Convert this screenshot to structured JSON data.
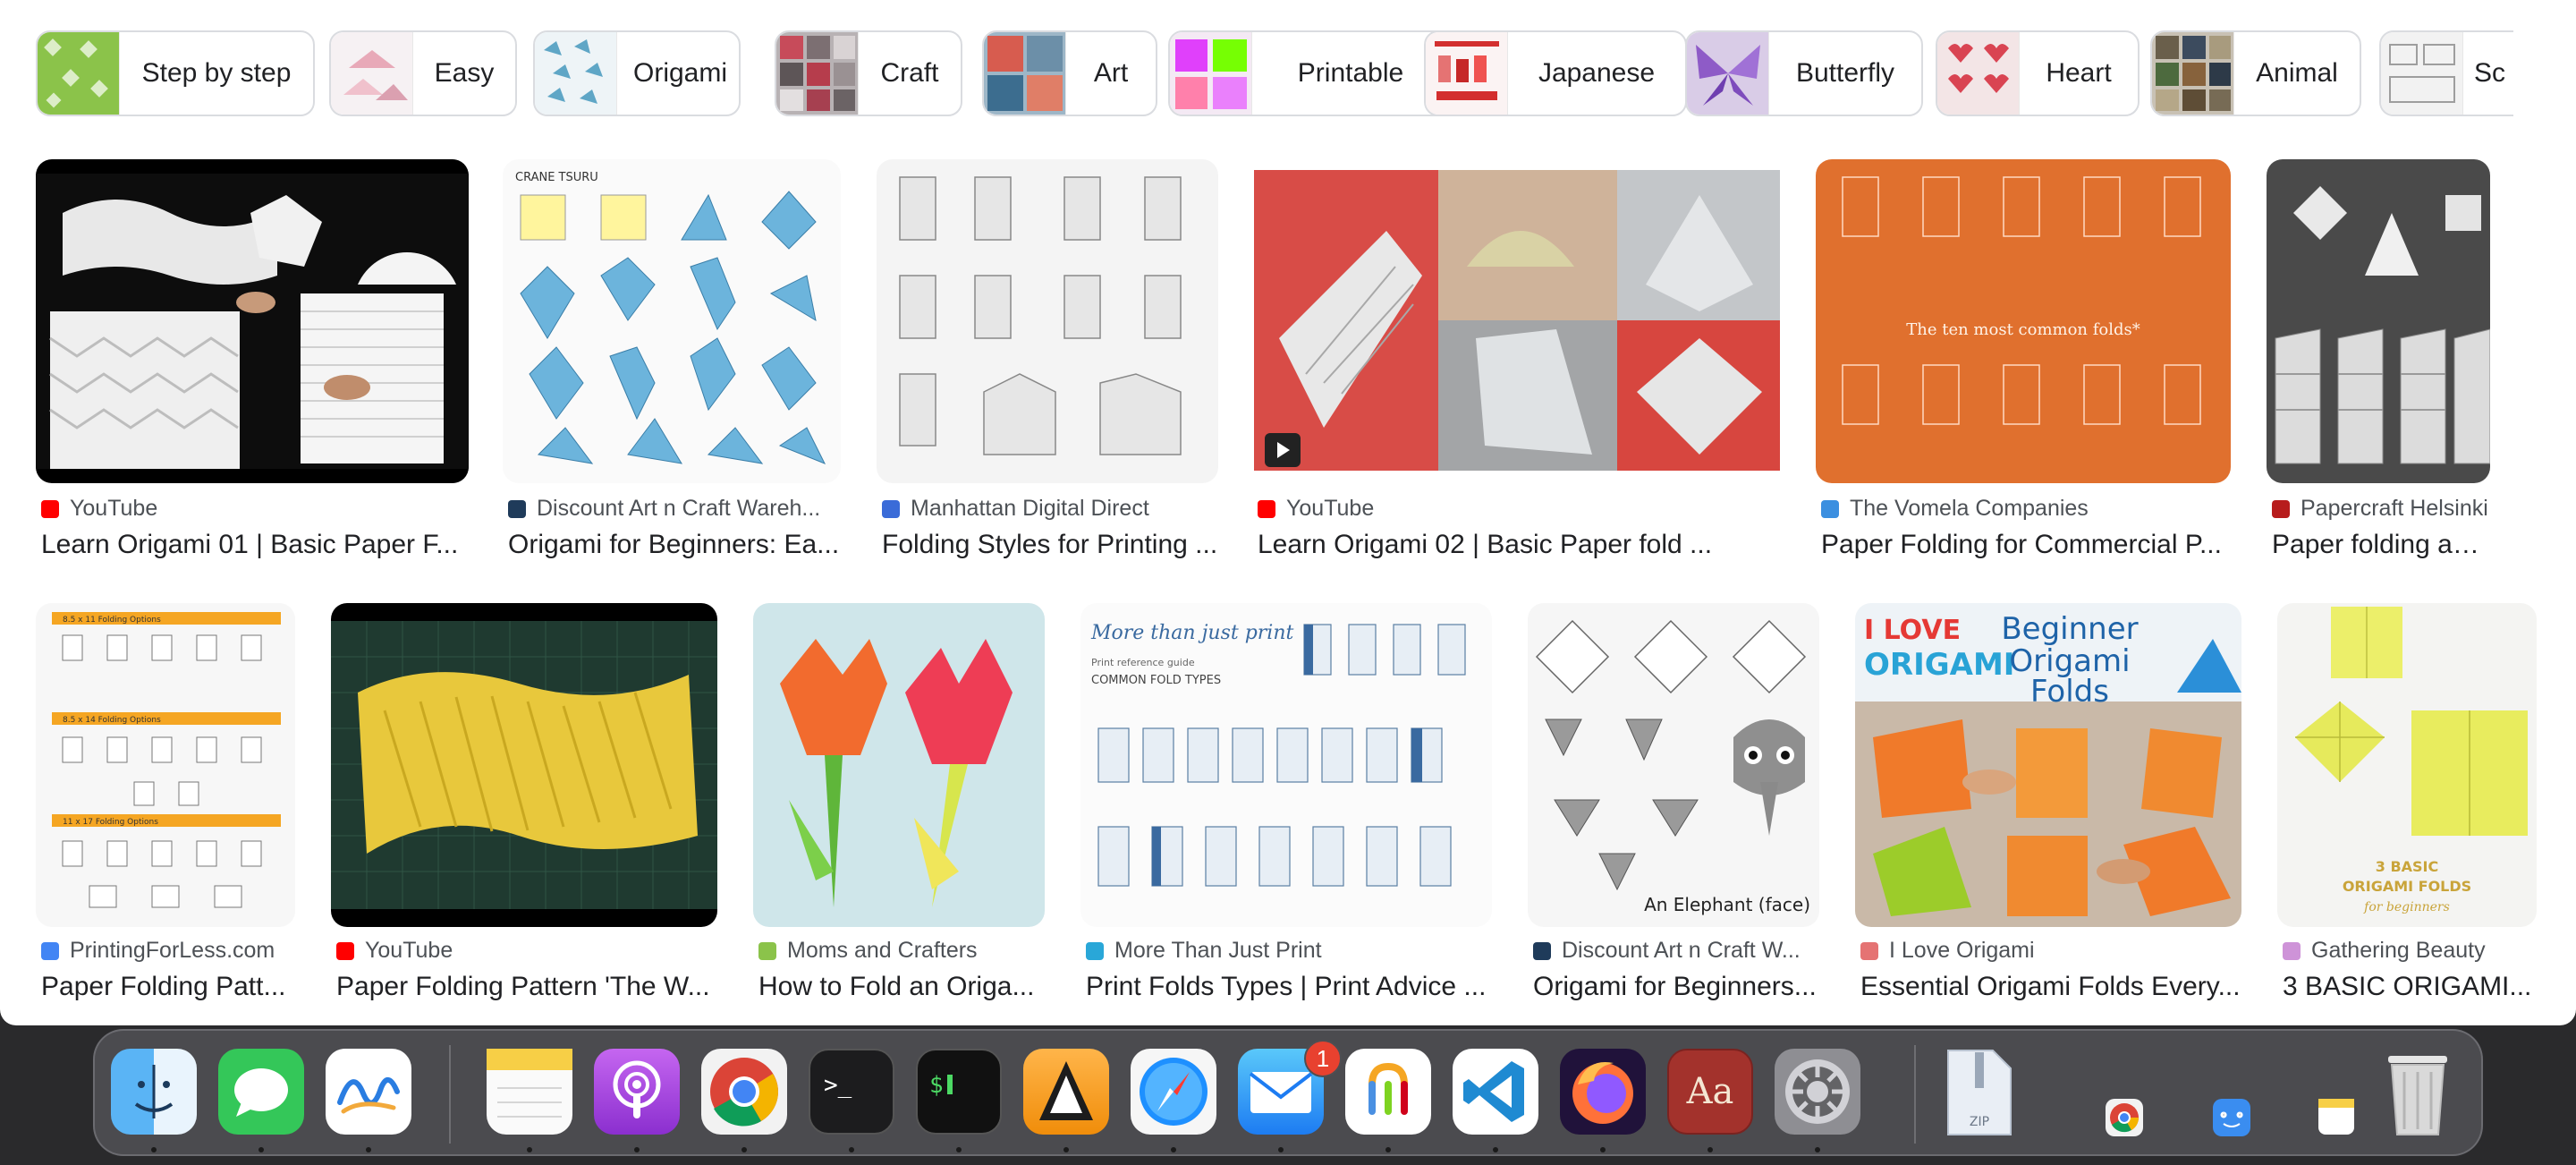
{
  "chips": [
    {
      "label": "Step by step"
    },
    {
      "label": "Easy"
    },
    {
      "label": "Origami"
    },
    {
      "label": "Craft"
    },
    {
      "label": "Art"
    },
    {
      "label": "Printable"
    },
    {
      "label": "Japanese"
    },
    {
      "label": "Butterfly"
    },
    {
      "label": "Heart"
    },
    {
      "label": "Animal"
    },
    {
      "label": "Sc"
    }
  ],
  "row1": [
    {
      "source": "YouTube",
      "title": "Learn Origami 01 | Basic Paper F..."
    },
    {
      "source": "Discount Art n Craft Wareh...",
      "title": "Origami for Beginners: Ea..."
    },
    {
      "source": "Manhattan Digital Direct",
      "title": "Folding Styles for Printing ..."
    },
    {
      "source": "YouTube",
      "title": "Learn Origami 02 | Basic Paper fold ..."
    },
    {
      "source": "The Vomela Companies",
      "title": "Paper Folding for Commercial P..."
    },
    {
      "source": "Papercraft Helsinki",
      "title": "Paper folding and d..."
    }
  ],
  "row2": [
    {
      "source": "PrintingForLess.com",
      "title": "Paper Folding Patt..."
    },
    {
      "source": "YouTube",
      "title": "Paper Folding Pattern 'The W..."
    },
    {
      "source": "Moms and Crafters",
      "title": "How to Fold an Origa..."
    },
    {
      "source": "More Than Just Print",
      "title": "Print Folds Types | Print Advice ..."
    },
    {
      "source": "Discount Art n Craft W...",
      "title": "Origami for Beginners..."
    },
    {
      "source": "I Love Origami",
      "title": "Essential Origami Folds Every..."
    },
    {
      "source": "Gathering Beauty",
      "title": "3 BASIC ORIGAMI..."
    }
  ],
  "thumb_text": {
    "crane_title": "CRANE TSURU",
    "vomela_caption": "The ten most common folds*",
    "mtjp_brand": "More than just print",
    "mtjp_sub": "Print reference guide",
    "mtjp_heading": "COMMON FOLD TYPES",
    "elephant_caption": "An Elephant (face)",
    "ilo_brand_1": "I LOVE",
    "ilo_brand_2": "ORIGAMI",
    "ilo_heading_1": "Beginner",
    "ilo_heading_2": "Origami",
    "ilo_heading_3": "Folds",
    "gb_caption_1": "3 BASIC",
    "gb_caption_2": "ORIGAMI FOLDS",
    "gb_caption_3": "for beginners",
    "pfl_header_1": "8.5 x 11 Folding Options",
    "pfl_header_2": "8.5 x 14 Folding Options",
    "pfl_header_3": "11 x 17 Folding Options"
  },
  "dock": {
    "items": [
      "finder-icon",
      "messages-icon",
      "freeform-icon",
      "notes-icon",
      "podcasts-icon",
      "chrome-icon",
      "terminal-icon",
      "iterm-icon",
      "vlc-icon",
      "safari-icon",
      "mail-icon",
      "figma-like-icon",
      "vscode-icon",
      "firefox-icon",
      "dictionary-icon",
      "system-settings-icon"
    ],
    "mail_badge": "1",
    "dictionary_label": "Aa",
    "zip_label": "ZIP"
  }
}
